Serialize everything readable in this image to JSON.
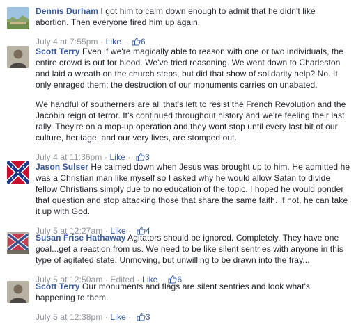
{
  "comments": [
    {
      "name": "Dennis Durham",
      "paragraphs": [
        "I got him to calm down enough to admit that he didn't like abortion. Then everyone fired him up again."
      ],
      "timestamp": "July 4 at 7:55pm",
      "sep": "·",
      "like_label": "Like",
      "sep2": "·",
      "like_count": "6",
      "avatar_icon": "landscape-avatar"
    },
    {
      "name": "Scott Terry",
      "paragraphs": [
        "Even if we're magically able to reason with one or two individuals, the entire crowd is out for blood. We've tried reasoning. We went down to Charleston and laid a wreath on the church steps, but did that show of solidarity help? No. It only enraged them; the destruction of our monuments carries on unabated.",
        "We handful of southerners are all that's left to resist the French Revolution and the Jacobin reign of terror. It's continued throughout history and we're feeling their last rally. They're on a mop-up operation and they wont stop until every last bit of our culture, heritage, and our very lives, are stomped out."
      ],
      "timestamp": "July 4 at 11:36pm",
      "sep": "·",
      "like_label": "Like",
      "sep2": "·",
      "like_count": "3",
      "avatar_icon": "portrait-avatar"
    },
    {
      "name": "Jason Sulser",
      "paragraphs": [
        "He calmed down when Jesus was brought up to him. He admitted he was a Christian man like myself so I asked why he would allow Satan to divide fellow Christians simply due to no education of the topic. I hoped he would ponder that question and stop attacking those that share the same faith. If not, he can take it up with God."
      ],
      "timestamp": "July 5 at 12:27am",
      "sep": "·",
      "like_label": "Like",
      "sep2": "·",
      "like_count": "4",
      "avatar_icon": "flag-avatar"
    },
    {
      "name": "Susan Frise Hathaway",
      "paragraphs": [
        "Agitators should be ignored. Completely. They have one goal...get a reaction from us. We need to be like silent sentries with anyone in this type of agitated state. Unmoving, but unwilling to be drawn into the fray..."
      ],
      "timestamp": "July 5 at 12:50am",
      "sep": "·",
      "edited_label": "Edited",
      "like_label": "Like",
      "sep2": "·",
      "like_count": "6",
      "avatar_icon": "flag-avatar"
    },
    {
      "name": "Scott Terry",
      "paragraphs": [
        "Our monuments and flags are silent sentries and look what's happening to them."
      ],
      "timestamp": "July 5 at 12:38pm",
      "sep": "·",
      "like_label": "Like",
      "sep2": "·",
      "like_count": "3",
      "avatar_icon": "portrait-avatar"
    }
  ],
  "colors": {
    "name": "#365899",
    "text": "#1d2129",
    "meta": "#90949c",
    "link": "#365899"
  }
}
